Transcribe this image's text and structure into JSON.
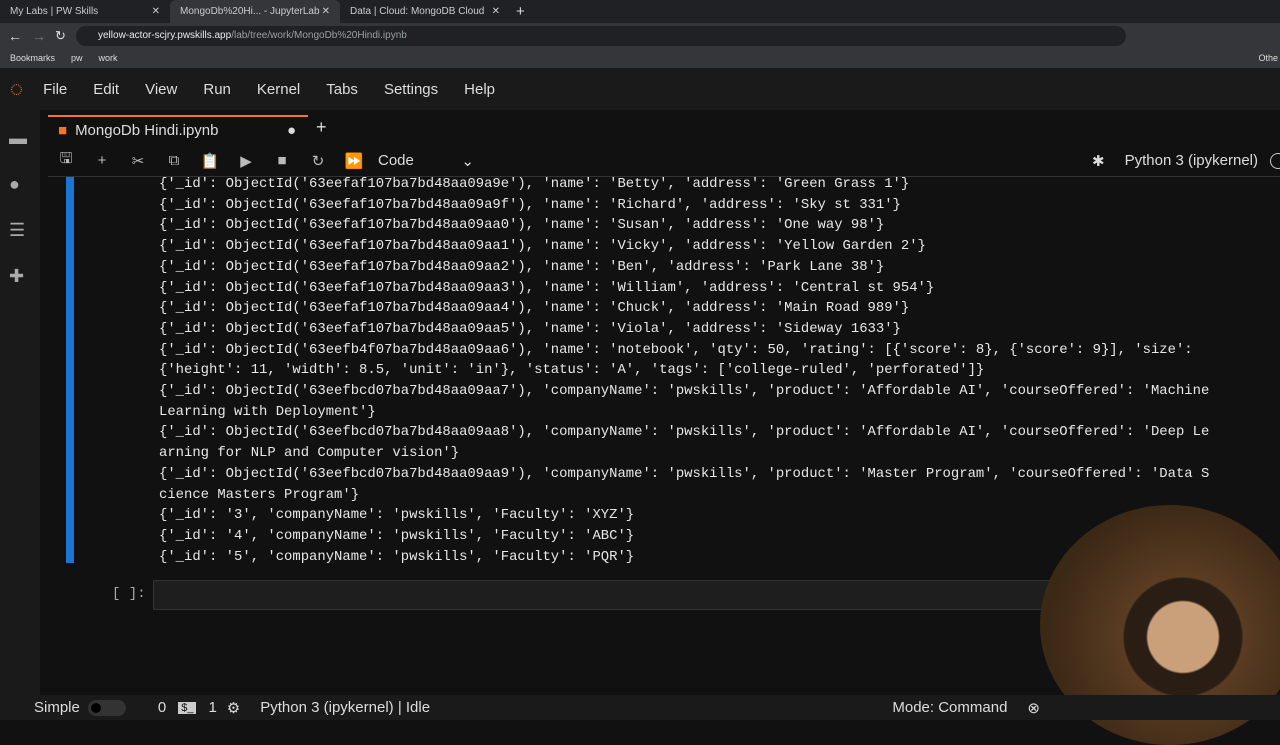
{
  "browser": {
    "tabs": [
      {
        "title": "My Labs | PW Skills"
      },
      {
        "title": "MongoDb%20Hi... - JupyterLab"
      },
      {
        "title": "Data | Cloud: MongoDB Cloud"
      }
    ],
    "url_host": "yellow-actor-scjry.pwskills.app",
    "url_path": "/lab/tree/work/MongoDb%20Hindi.ipynb",
    "bookmarks": [
      "Bookmarks",
      "pw",
      "work"
    ],
    "other": "Othe"
  },
  "menu": [
    "File",
    "Edit",
    "View",
    "Run",
    "Kernel",
    "Tabs",
    "Settings",
    "Help"
  ],
  "notebook_tab": "MongoDb Hindi.ipynb",
  "toolbar": {
    "cell_type": "Code",
    "kernel": "Python 3 (ipykernel)"
  },
  "output_lines": [
    "{'_id': ObjectId('63eefaf107ba7bd48aa09a9e'), 'name': 'Betty', 'address': 'Green Grass 1'}",
    "{'_id': ObjectId('63eefaf107ba7bd48aa09a9f'), 'name': 'Richard', 'address': 'Sky st 331'}",
    "{'_id': ObjectId('63eefaf107ba7bd48aa09aa0'), 'name': 'Susan', 'address': 'One way 98'}",
    "{'_id': ObjectId('63eefaf107ba7bd48aa09aa1'), 'name': 'Vicky', 'address': 'Yellow Garden 2'}",
    "{'_id': ObjectId('63eefaf107ba7bd48aa09aa2'), 'name': 'Ben', 'address': 'Park Lane 38'}",
    "{'_id': ObjectId('63eefaf107ba7bd48aa09aa3'), 'name': 'William', 'address': 'Central st 954'}",
    "{'_id': ObjectId('63eefaf107ba7bd48aa09aa4'), 'name': 'Chuck', 'address': 'Main Road 989'}",
    "{'_id': ObjectId('63eefaf107ba7bd48aa09aa5'), 'name': 'Viola', 'address': 'Sideway 1633'}",
    "{'_id': ObjectId('63eefb4f07ba7bd48aa09aa6'), 'name': 'notebook', 'qty': 50, 'rating': [{'score': 8}, {'score': 9}], 'size':",
    "{'height': 11, 'width': 8.5, 'unit': 'in'}, 'status': 'A', 'tags': ['college-ruled', 'perforated']}",
    "{'_id': ObjectId('63eefbcd07ba7bd48aa09aa7'), 'companyName': 'pwskills', 'product': 'Affordable AI', 'courseOffered': 'Machine",
    "Learning with Deployment'}",
    "{'_id': ObjectId('63eefbcd07ba7bd48aa09aa8'), 'companyName': 'pwskills', 'product': 'Affordable AI', 'courseOffered': 'Deep Le",
    "arning for NLP and Computer vision'}",
    "{'_id': ObjectId('63eefbcd07ba7bd48aa09aa9'), 'companyName': 'pwskills', 'product': 'Master Program', 'courseOffered': 'Data S",
    "cience Masters Program'}",
    "{'_id': '3', 'companyName': 'pwskills', 'Faculty': 'XYZ'}",
    "{'_id': '4', 'companyName': 'pwskills', 'Faculty': 'ABC'}",
    "{'_id': '5', 'companyName': 'pwskills', 'Faculty': 'PQR'}"
  ],
  "input_prompt": "[ ]:",
  "status": {
    "mode_simple": "Simple",
    "count0": "0",
    "count1": "1",
    "kernel": "Python 3 (ipykernel) | Idle",
    "mode": "Mode: Command"
  }
}
